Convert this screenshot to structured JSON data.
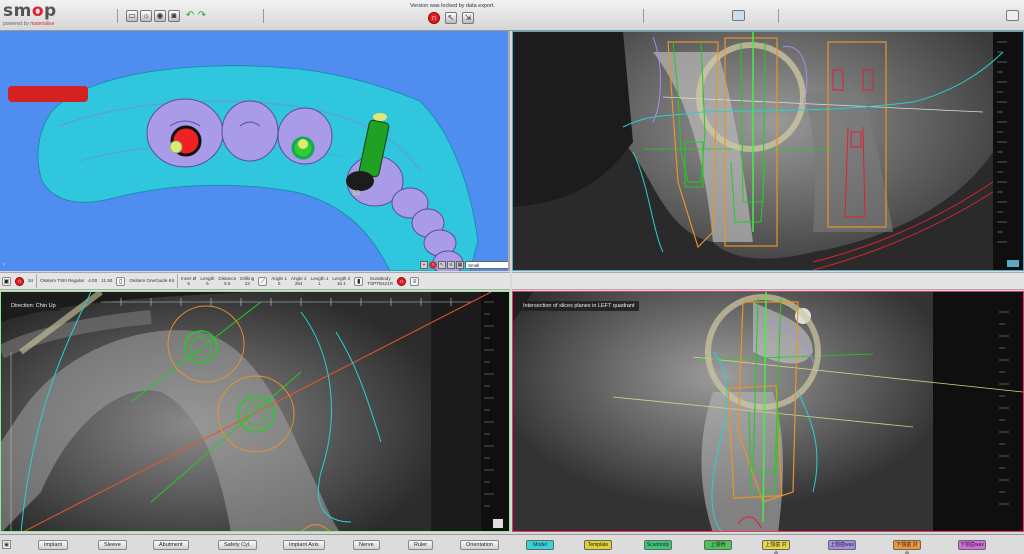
{
  "app": {
    "logo_main": "sm",
    "logo_o": "o",
    "logo_end": "p",
    "tagline_prefix": "powered by ",
    "tagline_brand": "materialise",
    "tagline_suffix": ""
  },
  "toolbar": {
    "lock_message": "Version was locked by data export."
  },
  "icons": [
    "monitor-icon",
    "bulb-icon",
    "camera-icon",
    "camera-icon",
    "undo-icon",
    "redo-icon",
    "lock-icon",
    "pointer-icon",
    "export-icon",
    "layout-icon",
    "maximize-icon"
  ],
  "views": {
    "bottom_left_label": "Direction: Chin Up",
    "bottom_right_label": "Intersection of slices planes in LEFT quadrant",
    "tooth_number": "33",
    "dropdown_value": "Small"
  },
  "info": {
    "tooth": "34",
    "implant": "Osstem TSIII Regular",
    "diameter": "4.00",
    "length": "11.50",
    "kit": "Osstem OneGuide Kit",
    "inner_label": "Inner Ø",
    "inner_value": "5",
    "length_label": "Length",
    "length_value": "5",
    "distance_label": "Distance",
    "distance_value": "5.5",
    "drilling_label": "Drilling",
    "drilling_value": "22",
    "angle1_label": "Angle 1",
    "angle1_value": "0",
    "angle2_label": "Angle 2",
    "angle2_value": "264",
    "length1_label": "Length 1",
    "length1_value": "1",
    "length2_label": "Length 2",
    "length2_value": "15.1",
    "scanbody_label": "ScanBody",
    "scanbody_value": "TSPTB421R"
  },
  "bottom": {
    "left_buttons": [
      "Implant",
      "Sleeve",
      "Abutment",
      "Safety Cyl.",
      "Implant Axis",
      "Nerve",
      "Ruler",
      "Orientation"
    ],
    "right_buttons": [
      {
        "label": "Model",
        "color": "#35d4dd"
      },
      {
        "label": "Template",
        "color": "#e0d030"
      },
      {
        "label": "Scanbody",
        "color": "#3cc87a"
      },
      {
        "label": "上顎骨",
        "color": "#4cc25a"
      },
      {
        "label": "上顎歯 対合",
        "color": "#e7d744"
      },
      {
        "label": "上顎歯wax",
        "color": "#a78be8"
      },
      {
        "label": "下顎歯 対合",
        "color": "#f0963a"
      },
      {
        "label": "下顎歯wax",
        "color": "#d56be0"
      }
    ]
  },
  "colors": {
    "model": "#38c8e0",
    "implant": "#d43030",
    "template": "#e8942a",
    "green": "#27d23a",
    "nerve": "#28d0d0"
  }
}
